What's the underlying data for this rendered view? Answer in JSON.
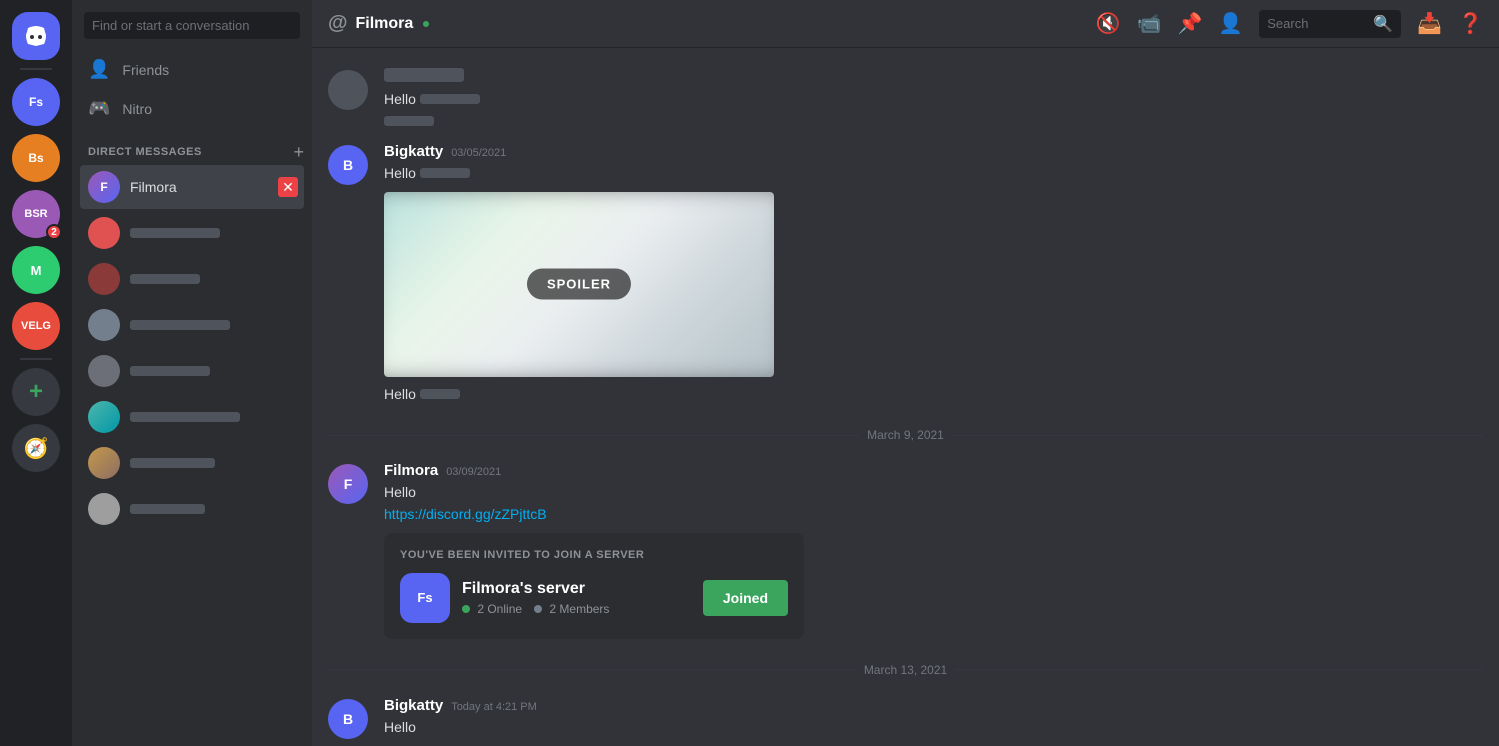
{
  "app": {
    "title": "DISCORD"
  },
  "titlebar": {
    "minimize": "─",
    "maximize": "□",
    "close": "✕"
  },
  "server_sidebar": {
    "home_label": "DC",
    "servers": [
      {
        "id": "fs",
        "label": "Fs",
        "color": "#5865f2"
      },
      {
        "id": "bs",
        "label": "Bs",
        "color": "#e67e22"
      },
      {
        "id": "bsr",
        "label": "BSR",
        "color": "#9b59b6"
      },
      {
        "id": "m",
        "label": "M",
        "color": "#2ecc71"
      },
      {
        "id": "velg",
        "label": "VELG",
        "color": "#e74c3c"
      },
      {
        "id": "add",
        "label": "+",
        "color": "#3ba55d"
      },
      {
        "id": "discover",
        "label": "🧭",
        "color": "#36393f"
      }
    ],
    "badge": "2"
  },
  "dm_panel": {
    "search_placeholder": "Find or start a conversation",
    "nav_items": [
      {
        "id": "friends",
        "label": "Friends",
        "icon": "👤"
      },
      {
        "id": "nitro",
        "label": "Nitro",
        "icon": "🎮"
      }
    ],
    "direct_messages_label": "DIRECT MESSAGES",
    "add_dm_label": "+",
    "dm_items": [
      {
        "id": "filmora",
        "name": "Filmora",
        "avatar_label": "F",
        "color": "#9b59b6",
        "active": true,
        "show_close": true
      },
      {
        "id": "dm2",
        "name": "",
        "avatar_label": "",
        "color": "#e05252",
        "active": false,
        "blurred": true
      },
      {
        "id": "dm3",
        "name": "",
        "avatar_label": "",
        "color": "#8b3a3a",
        "active": false,
        "blurred": true
      },
      {
        "id": "dm4",
        "name": "",
        "avatar_label": "",
        "color": "#747f8d",
        "active": false,
        "blurred": true
      },
      {
        "id": "dm5",
        "name": "",
        "avatar_label": "",
        "color": "#747f8d",
        "active": false,
        "blurred": true
      },
      {
        "id": "dm6",
        "name": "",
        "avatar_label": "",
        "color": "#4db6ac",
        "color2": "#0097a7",
        "active": false,
        "blurred": true
      },
      {
        "id": "dm7",
        "name": "",
        "avatar_label": "",
        "color": "#8d6e63",
        "active": false,
        "blurred": true
      },
      {
        "id": "dm8",
        "name": "",
        "avatar_label": "",
        "color": "#bdbdbd",
        "active": false,
        "blurred": true
      }
    ]
  },
  "chat": {
    "header_name": "Filmora",
    "header_status": "online",
    "search_placeholder": "Search",
    "icons": {
      "mute": "🔇",
      "video": "📹",
      "pin": "📌",
      "add_friend": "👤",
      "inbox": "📥",
      "help": "❓"
    }
  },
  "messages": [
    {
      "id": "msg0",
      "username": "",
      "timestamp": "",
      "avatar_label": "",
      "avatar_color": "#4f545c",
      "texts": [
        "Hello",
        ""
      ],
      "blurred_parts": [
        true,
        false,
        true
      ]
    },
    {
      "id": "msg1",
      "username": "Bigkatty",
      "timestamp": "03/05/2021",
      "avatar_label": "B",
      "avatar_color": "#5865f2",
      "texts": [
        "Hello"
      ],
      "has_spoiler": true
    },
    {
      "id": "msg1b",
      "username": "",
      "timestamp": "",
      "avatar_label": "",
      "continuation": true,
      "texts": [
        "Hello"
      ],
      "blurred_after": true
    },
    {
      "id": "divider1",
      "type": "divider",
      "label": "March 9, 2021"
    },
    {
      "id": "msg2",
      "username": "Filmora",
      "timestamp": "03/09/2021",
      "avatar_label": "F",
      "avatar_color": "#9b59b6",
      "texts": [
        "Hello"
      ],
      "invite_link": "https://discord.gg/zZPjttcB",
      "has_invite": true
    },
    {
      "id": "divider2",
      "type": "divider",
      "label": "March 13, 2021"
    },
    {
      "id": "msg3",
      "username": "Bigkatty",
      "timestamp": "Today at 4:21 PM",
      "avatar_label": "B",
      "avatar_color": "#5865f2",
      "texts": [
        "Hello"
      ]
    }
  ],
  "invite_card": {
    "header": "YOU'VE BEEN INVITED TO JOIN A SERVER",
    "server_name": "Filmora's server",
    "server_icon": "Fs",
    "online_count": "2 Online",
    "member_count": "2 Members",
    "joined_label": "Joined"
  },
  "spoiler": {
    "label": "SPOILER"
  }
}
